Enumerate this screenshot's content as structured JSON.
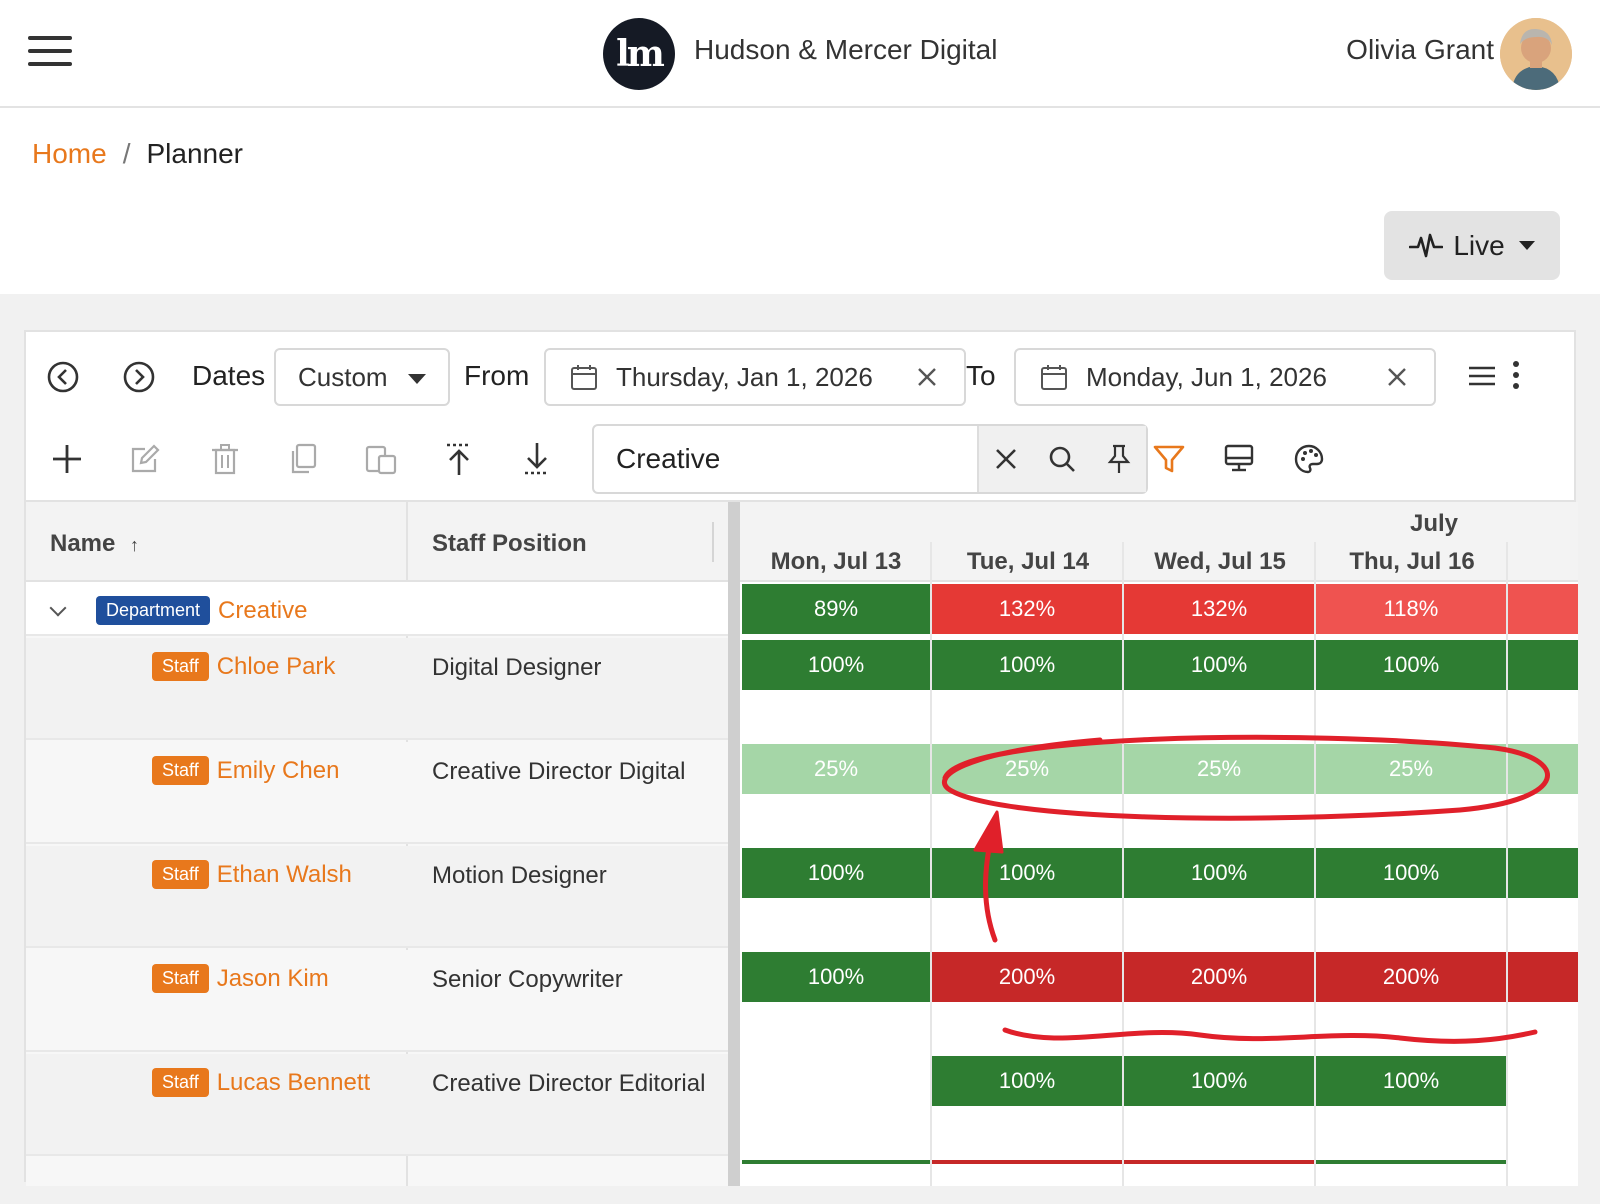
{
  "app": {
    "brand_name": "Hudson & Mercer Digital",
    "brand_logo_text": "hm",
    "user_name": "Olivia Grant"
  },
  "breadcrumb": {
    "home": "Home",
    "separator": "/",
    "current": "Planner"
  },
  "live_button": {
    "label": "Live"
  },
  "toolbar": {
    "dates_label": "Dates",
    "dates_mode": "Custom",
    "from_label": "From",
    "from_date": "Thursday, Jan 1, 2026",
    "to_label": "To",
    "to_date": "Monday, Jun 1, 2026",
    "search_value": "Creative"
  },
  "grid": {
    "columns": {
      "name": "Name",
      "name_sort": "↑",
      "position": "Staff Position"
    },
    "month": "July",
    "days": [
      "Mon, Jul 13",
      "Tue, Jul 14",
      "Wed, Jul 15",
      "Thu, Jul 16"
    ],
    "department": {
      "badge": "Department",
      "name": "Creative",
      "allocations": [
        "89%",
        "132%",
        "132%",
        "118%"
      ]
    },
    "staff": [
      {
        "badge": "Staff",
        "name": "Chloe Park",
        "position": "Digital Designer",
        "allocations": [
          "100%",
          "100%",
          "100%",
          "100%"
        ]
      },
      {
        "badge": "Staff",
        "name": "Emily Chen",
        "position": "Creative Director Digital",
        "allocations": [
          "25%",
          "25%",
          "25%",
          "25%"
        ]
      },
      {
        "badge": "Staff",
        "name": "Ethan Walsh",
        "position": "Motion Designer",
        "allocations": [
          "100%",
          "100%",
          "100%",
          "100%"
        ]
      },
      {
        "badge": "Staff",
        "name": "Jason Kim",
        "position": "Senior Copywriter",
        "allocations": [
          "100%",
          "200%",
          "200%",
          "200%"
        ]
      },
      {
        "badge": "Staff",
        "name": "Lucas Bennett",
        "position": "Creative Director Editorial",
        "allocations": [
          "",
          "100%",
          "100%",
          "100%"
        ]
      }
    ]
  },
  "colors": {
    "accent": "#e8781c",
    "dept_badge": "#1f4f9c",
    "green": "#2e7d32",
    "light_green": "#a5d6a7",
    "red": "#e53935",
    "light_red": "#ef5350",
    "dark_red": "#c62828",
    "annotation": "#e0202a"
  }
}
